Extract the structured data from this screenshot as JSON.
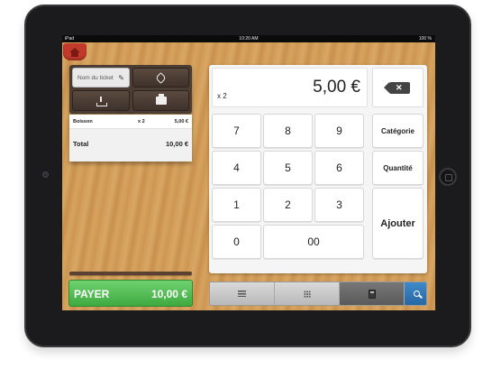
{
  "status_bar": {
    "carrier": "iPad",
    "time": "10:20 AM",
    "battery": "100 %"
  },
  "ticket_toolbar": {
    "ticket_name_placeholder": "Nom du ticket"
  },
  "ticket": {
    "rows": [
      {
        "name": "Boisson",
        "qty": "x 2",
        "price": "5,00 €"
      }
    ],
    "total_label": "Total",
    "total_value": "10,00 €"
  },
  "pay": {
    "label": "PAYER",
    "amount": "10,00 €"
  },
  "keypad": {
    "display_qty": "x 2",
    "display_amount": "5,00 €",
    "keys": {
      "k7": "7",
      "k8": "8",
      "k9": "9",
      "k4": "4",
      "k5": "5",
      "k6": "6",
      "k1": "1",
      "k2": "2",
      "k3": "3",
      "k0": "0",
      "k00": "00"
    },
    "side": {
      "categorie": "Catégorie",
      "quantite": "Quantité",
      "ajouter": "Ajouter"
    }
  },
  "bottom_bar": {
    "items": [
      "list-icon",
      "grid-icon",
      "calculator-icon",
      "search-icon"
    ],
    "active": "calculator-icon",
    "accent": "#3f89c9"
  },
  "colors": {
    "pay_green": "#4fbf50",
    "home_red": "#c23a2b",
    "wood": "#d3a05e"
  }
}
